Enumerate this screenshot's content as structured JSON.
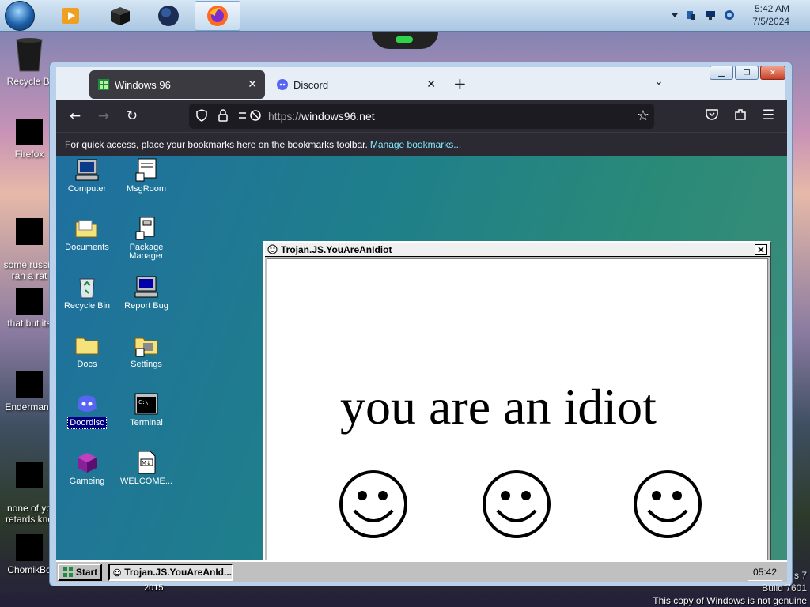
{
  "host_taskbar": {
    "clock_time": "5:42 AM",
    "clock_date": "7/5/2024",
    "pinned": [
      "media-player-icon",
      "box-app-icon",
      "globe-app-icon",
      "firefox-icon"
    ]
  },
  "host_desktop": {
    "icons": [
      {
        "label": "Recycle Bi",
        "icon": "recycle-bin-icon"
      },
      {
        "label": "Firefox",
        "icon": "firefox-icon"
      },
      {
        "label": "some russia\nran a rat",
        "icon": "file-icon"
      },
      {
        "label": "that but its",
        "icon": "file-icon"
      },
      {
        "label": "Endermanc",
        "icon": "app-icon"
      },
      {
        "label": "none of yo\nretards kno",
        "icon": "app-icon"
      },
      {
        "label": "ChomikBo",
        "icon": "app-icon"
      }
    ],
    "year_label": "2015",
    "watermark": {
      "line1": "s 7",
      "line2": "Build 7601",
      "line3": "This copy of Windows is not genuine"
    }
  },
  "browser": {
    "tabs": [
      {
        "label": "Windows 96",
        "active": true
      },
      {
        "label": "Discord",
        "active": false
      }
    ],
    "url_scheme": "https://",
    "url_host": "windows96.net",
    "bookmarks_msg": "For quick access, place your bookmarks here on the bookmarks toolbar.",
    "bookmarks_link": "Manage bookmarks..."
  },
  "win96": {
    "icons_col1": [
      "Computer",
      "Documents",
      "Recycle Bin",
      "Docs",
      "Doordisc",
      "Gameing"
    ],
    "icons_col2": [
      "MsgRoom",
      "Package Manager",
      "Report Bug",
      "Settings",
      "Terminal",
      "WELCOME..."
    ],
    "trojan": {
      "title": "Trojan.JS.YouAreAnIdiot",
      "message": "you are an idiot"
    },
    "taskbar": {
      "start_label": "Start",
      "task_label": "Trojan.JS.YouAreAnId...",
      "clock": "05:42"
    }
  },
  "colors": {
    "browser_chrome": "#2b2a33",
    "link": "#80ebff",
    "win96_teal": "#1f7f8a",
    "win96_gray": "#c0c0c0"
  }
}
